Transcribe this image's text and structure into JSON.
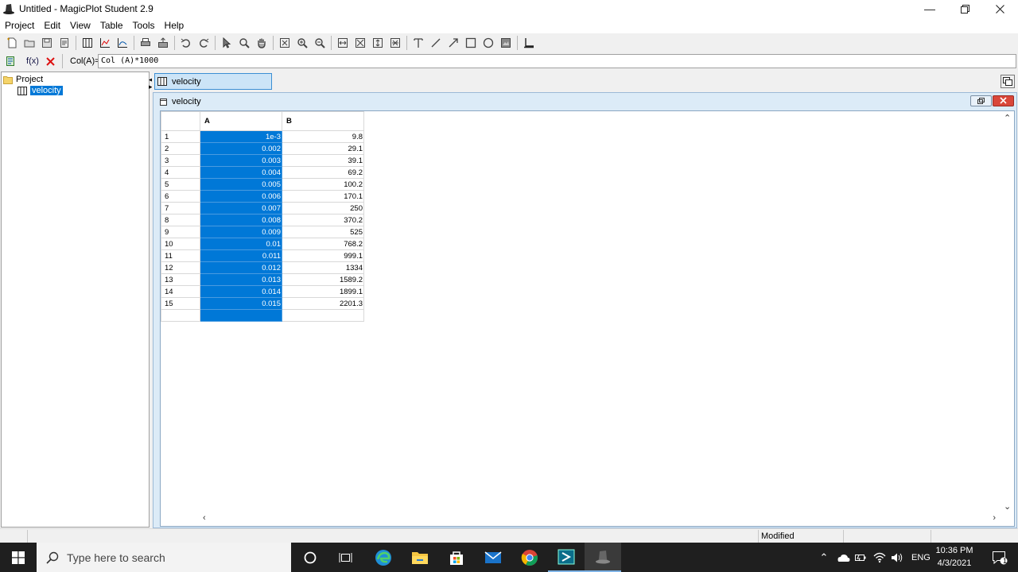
{
  "window": {
    "title": "Untitled - MagicPlot Student 2.9"
  },
  "menu": [
    "Project",
    "Edit",
    "View",
    "Table",
    "Tools",
    "Help"
  ],
  "formula": {
    "label": "Col(A)=",
    "value": "Col (A)*1000"
  },
  "project_tree": {
    "root": "Project",
    "item": "velocity"
  },
  "document_tab": {
    "label": "velocity"
  },
  "child_window": {
    "title": "velocity"
  },
  "table": {
    "columns": [
      "A",
      "B"
    ],
    "rows": [
      {
        "n": "1",
        "a": "1e-3",
        "b": "9.8"
      },
      {
        "n": "2",
        "a": "0.002",
        "b": "29.1"
      },
      {
        "n": "3",
        "a": "0.003",
        "b": "39.1"
      },
      {
        "n": "4",
        "a": "0.004",
        "b": "69.2"
      },
      {
        "n": "5",
        "a": "0.005",
        "b": "100.2"
      },
      {
        "n": "6",
        "a": "0.006",
        "b": "170.1"
      },
      {
        "n": "7",
        "a": "0.007",
        "b": "250"
      },
      {
        "n": "8",
        "a": "0.008",
        "b": "370.2"
      },
      {
        "n": "9",
        "a": "0.009",
        "b": "525"
      },
      {
        "n": "10",
        "a": "0.01",
        "b": "768.2"
      },
      {
        "n": "11",
        "a": "0.011",
        "b": "999.1"
      },
      {
        "n": "12",
        "a": "0.012",
        "b": "1334"
      },
      {
        "n": "13",
        "a": "0.013",
        "b": "1589.2"
      },
      {
        "n": "14",
        "a": "0.014",
        "b": "1899.1"
      },
      {
        "n": "15",
        "a": "0.015",
        "b": "2201.3"
      },
      {
        "n": "",
        "a": "",
        "b": ""
      }
    ]
  },
  "status": {
    "modified": "Modified"
  },
  "taskbar": {
    "search_placeholder": "Type here to search",
    "lang": "ENG",
    "time": "10:36 PM",
    "date": "4/3/2021",
    "notification_count": "1"
  },
  "colors": {
    "selection": "#0078d7",
    "taskbar": "#1f1f1f"
  }
}
